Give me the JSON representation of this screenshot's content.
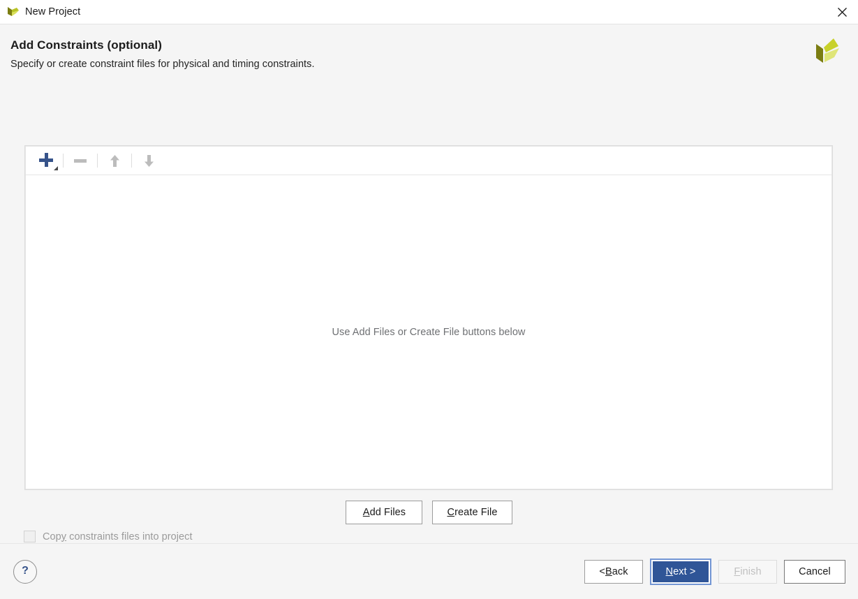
{
  "window": {
    "title": "New Project",
    "logo_icon": "vivado-logo-icon",
    "close_icon": "close-icon"
  },
  "header": {
    "title": "Add Constraints (optional)",
    "subtitle": "Specify or create constraint files for physical and timing constraints.",
    "logo_icon": "xilinx-logo-icon"
  },
  "toolbar": {
    "add_icon": "plus-icon",
    "add_dropdown_icon": "caret-down-icon",
    "remove_icon": "minus-icon",
    "move_up_icon": "arrow-up-icon",
    "move_down_icon": "arrow-down-icon"
  },
  "list": {
    "empty_message": "Use Add Files or Create File buttons below"
  },
  "file_actions": {
    "add_files": {
      "prefix": "",
      "mnemonic": "A",
      "suffix": "dd Files"
    },
    "create_file": {
      "prefix": "",
      "mnemonic": "C",
      "suffix": "reate File"
    }
  },
  "copy_option": {
    "label_prefix": "Cop",
    "label_mnemonic": "y",
    "label_suffix": " constraints files into project",
    "checked": false,
    "enabled": false
  },
  "footer": {
    "help_label": "?",
    "back": {
      "prefix": "< ",
      "mnemonic": "B",
      "suffix": "ack"
    },
    "next": {
      "prefix": "",
      "mnemonic": "N",
      "suffix": "ext >"
    },
    "finish": {
      "prefix": "",
      "mnemonic": "F",
      "suffix": "inish"
    },
    "cancel": {
      "prefix": "Cancel",
      "mnemonic": "",
      "suffix": ""
    }
  },
  "colors": {
    "accent_blue": "#2f5597",
    "icon_blue": "#36538a",
    "focus_ring": "#7396d4",
    "body_bg": "#f5f5f5",
    "logo_dark": "#7b7d12",
    "logo_mid": "#c8d12a",
    "logo_light": "#d9e05a"
  }
}
